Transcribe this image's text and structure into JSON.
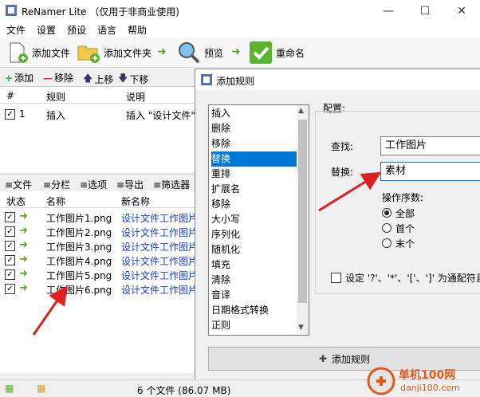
{
  "app": {
    "title": "ReNamer Lite （仅用于非商业使用)"
  },
  "menu": [
    "文件",
    "设置",
    "预设",
    "语言",
    "帮助"
  ],
  "toolbar": {
    "add_files": "添加文件",
    "add_folder": "添加文件夹",
    "preview": "预览",
    "rename": "重命名"
  },
  "rules_toolbar": {
    "add": "添加",
    "remove": "移除",
    "up": "上移",
    "down": "下移"
  },
  "rules_table": {
    "headers": [
      "#",
      "规则",
      "说明"
    ],
    "rows": [
      {
        "num": "1",
        "rule": "插入",
        "desc": "插入 \"设计文件\""
      }
    ]
  },
  "files_toolbar": {
    "files": "文件",
    "columns": "分栏",
    "options": "选项",
    "export": "导出",
    "filter": "筛选器"
  },
  "files_table": {
    "headers": [
      "状态",
      "名称",
      "新名称"
    ],
    "rows": [
      {
        "name": "工作图片1.png",
        "new": "设计文件工作图片"
      },
      {
        "name": "工作图片2.png",
        "new": "设计文件工作图片"
      },
      {
        "name": "工作图片3.png",
        "new": "设计文件工作图片"
      },
      {
        "name": "工作图片4.png",
        "new": "设计文件工作图片"
      },
      {
        "name": "工作图片5.png",
        "new": "设计文件工作图片"
      },
      {
        "name": "工作图片6.png",
        "new": "设计文件工作图片"
      }
    ]
  },
  "status": {
    "count": "6 个文件 (86.07 MB)"
  },
  "dialog": {
    "title": "添加规则",
    "rules": [
      "插入",
      "删除",
      "移除",
      "替换",
      "重排",
      "扩展名",
      "移除",
      "大小写",
      "序列化",
      "随机化",
      "填充",
      "清除",
      "音译",
      "日期格式转换",
      "正则"
    ],
    "selected_index": 3,
    "config_label": "配置:",
    "find_label": "查找:",
    "find_value": "工作图片",
    "replace_label": "替换:",
    "replace_value": "素材",
    "occurrence_label": "操作序数:",
    "occurrences": [
      "全部",
      "首个",
      "末个"
    ],
    "wildcard_label": "设定 '?'、'*'、'['、']' 为通配符且",
    "add_rule_button": "添加规则"
  },
  "watermark": {
    "text": "单机100网",
    "url": "danji100.com"
  }
}
